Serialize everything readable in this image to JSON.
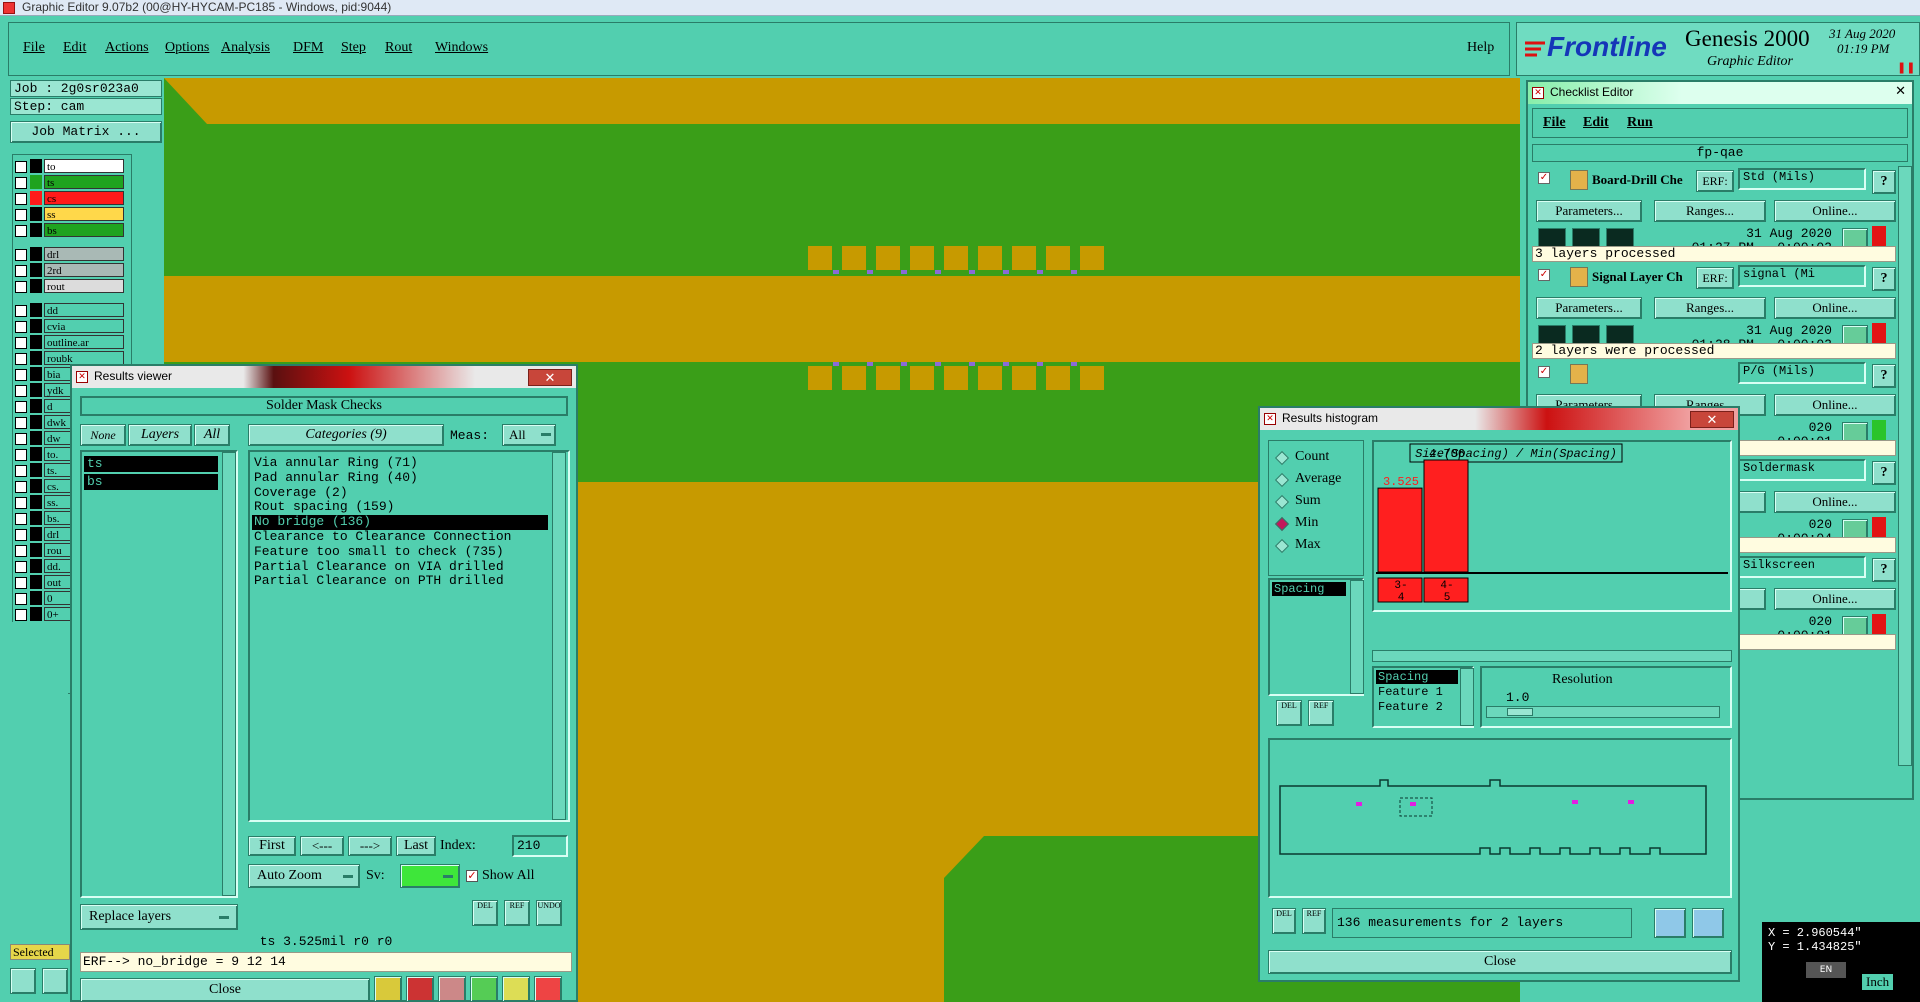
{
  "os_titlebar": {
    "title": "Graphic Editor 9.07b2 (00@HY-HYCAM-PC185 - Windows, pid:9044)"
  },
  "menubar": {
    "items": [
      "File",
      "Edit",
      "Actions",
      "Options",
      "Analysis",
      "DFM",
      "Step",
      "Rout",
      "Windows"
    ],
    "help": "Help"
  },
  "brand": {
    "logo": "Frontline",
    "product": "Genesis 2000",
    "subtitle": "Graphic Editor",
    "date": "31 Aug 2020",
    "time": "01:19 PM"
  },
  "job": {
    "job_label": "Job : 2g0sr023a0",
    "step_label": "Step: cam",
    "matrix_button": "Job Matrix ..."
  },
  "layers": [
    {
      "name": "to",
      "color": "#ffffff"
    },
    {
      "name": "ts",
      "color": "#1fa31f"
    },
    {
      "name": "cs",
      "color": "#ff1a1a"
    },
    {
      "name": "ss",
      "color": "#ffd84a"
    },
    {
      "name": "bs",
      "color": "#1fa31f"
    },
    {
      "name": "drl",
      "color": "#a9b9b5"
    },
    {
      "name": "2rd",
      "color": "#a9b9b5"
    },
    {
      "name": "rout",
      "color": "#dcdcdc"
    },
    {
      "name": "dd",
      "color": "#52cfaf"
    },
    {
      "name": "cvia",
      "color": "#52cfaf"
    },
    {
      "name": "outline.ar",
      "color": "#52cfaf"
    },
    {
      "name": "roubk",
      "color": "#52cfaf"
    },
    {
      "name": "bia",
      "color": "#52cfaf"
    },
    {
      "name": "ydk",
      "color": "#52cfaf"
    },
    {
      "name": "d",
      "color": "#52cfaf"
    },
    {
      "name": "dwk",
      "color": "#52cfaf"
    },
    {
      "name": "dw",
      "color": "#52cfaf"
    },
    {
      "name": "to.",
      "color": "#52cfaf"
    },
    {
      "name": "ts.",
      "color": "#52cfaf"
    },
    {
      "name": "cs.",
      "color": "#52cfaf"
    },
    {
      "name": "ss.",
      "color": "#52cfaf"
    },
    {
      "name": "bs.",
      "color": "#52cfaf"
    },
    {
      "name": "drl",
      "color": "#52cfaf"
    },
    {
      "name": "rou",
      "color": "#52cfaf"
    },
    {
      "name": "dd.",
      "color": "#52cfaf"
    },
    {
      "name": "out",
      "color": "#52cfaf"
    },
    {
      "name": "0",
      "color": "#52cfaf"
    },
    {
      "name": "0+",
      "color": "#52cfaf"
    }
  ],
  "selected_label": "Selected",
  "results_viewer": {
    "title": "Results viewer",
    "header": "Solder Mask Checks",
    "none_btn": "None",
    "layers_btn": "Layers",
    "all_btn": "All",
    "categories_btn": "Categories (9)",
    "meas_label": "Meas:",
    "meas_value": "All",
    "layer_list": [
      "ts",
      "bs"
    ],
    "categories": [
      "Via annular Ring (71)",
      "Pad annular Ring (40)",
      "Coverage (2)",
      "Rout spacing (159)",
      "No bridge (136)",
      "Clearance to Clearance Connection",
      "Feature too small to check (735)",
      "Partial Clearance on VIA drilled",
      "Partial Clearance on PTH drilled"
    ],
    "selected_category": "No bridge (136)",
    "nav": {
      "first": "First",
      "prev": "<---",
      "next": "--->",
      "last": "Last",
      "index_label": "Index:",
      "index_value": "210"
    },
    "auto_zoom": "Auto Zoom",
    "sv_label": "Sv:",
    "show_all": "Show All",
    "replace_layers": "Replace layers",
    "status": "ts 3.525mil   r0   r0",
    "erf": "ERF--> no_bridge = 9 12 14",
    "close": "Close"
  },
  "checklist": {
    "title": "Checklist Editor",
    "menu": [
      "File",
      "Edit",
      "Run"
    ],
    "name": "fp-qae",
    "items": [
      {
        "name": "Board-Drill Che",
        "erf_label": "ERF:",
        "erf_value": "Std (Mils)",
        "date": "31 Aug 2020",
        "time": "01:27 PM - 0:00:02",
        "status": "3 layers processed"
      },
      {
        "name": "Signal Layer Ch",
        "erf_label": "ERF:",
        "erf_value": "signal (Mi",
        "date": "31 Aug 2020",
        "time": "01:28 PM - 0:00:02",
        "status": "2 layers were processed"
      },
      {
        "erf_value": "P/G (Mils)",
        "date": "020",
        "time": "0:00:01",
        "status": "processed"
      },
      {
        "erf_value": "Soldermask",
        "date": "020",
        "time": "0:00:04",
        "status": "re processed"
      },
      {
        "erf_value": "Silkscreen",
        "date": "020",
        "time": "0:00:01",
        "status": "ocessed"
      }
    ],
    "params_btn": "Parameters...",
    "ranges_btn": "Ranges...",
    "online_btn": "Online..."
  },
  "histogram": {
    "title": "Results histogram",
    "modes": [
      "Count",
      "Average",
      "Sum",
      "Min",
      "Max"
    ],
    "selected_mode": "Min",
    "attr_list": [
      "Spacing"
    ],
    "chart_title": "Size(Spacing) / Min(Spacing)",
    "feature_list": [
      "Spacing",
      "Feature 1",
      "Feature 2"
    ],
    "resolution_label": "Resolution",
    "resolution_value": "1.0",
    "summary": "136 measurements for 2 layers",
    "close": "Close",
    "del_btn": "DEL",
    "ref_btn": "REF"
  },
  "chart_data": {
    "type": "bar",
    "categories": [
      "3-4",
      "4-5"
    ],
    "values": [
      3.525,
      4.706
    ],
    "title": "Size(Spacing) / Min(Spacing)",
    "xlabel": "",
    "ylabel": "",
    "ylim": [
      0,
      4.706
    ]
  },
  "coords": {
    "x": "X = 2.960544\"",
    "y": "Y = 1.434825\"",
    "unit": "Inch",
    "lang": "EN"
  }
}
